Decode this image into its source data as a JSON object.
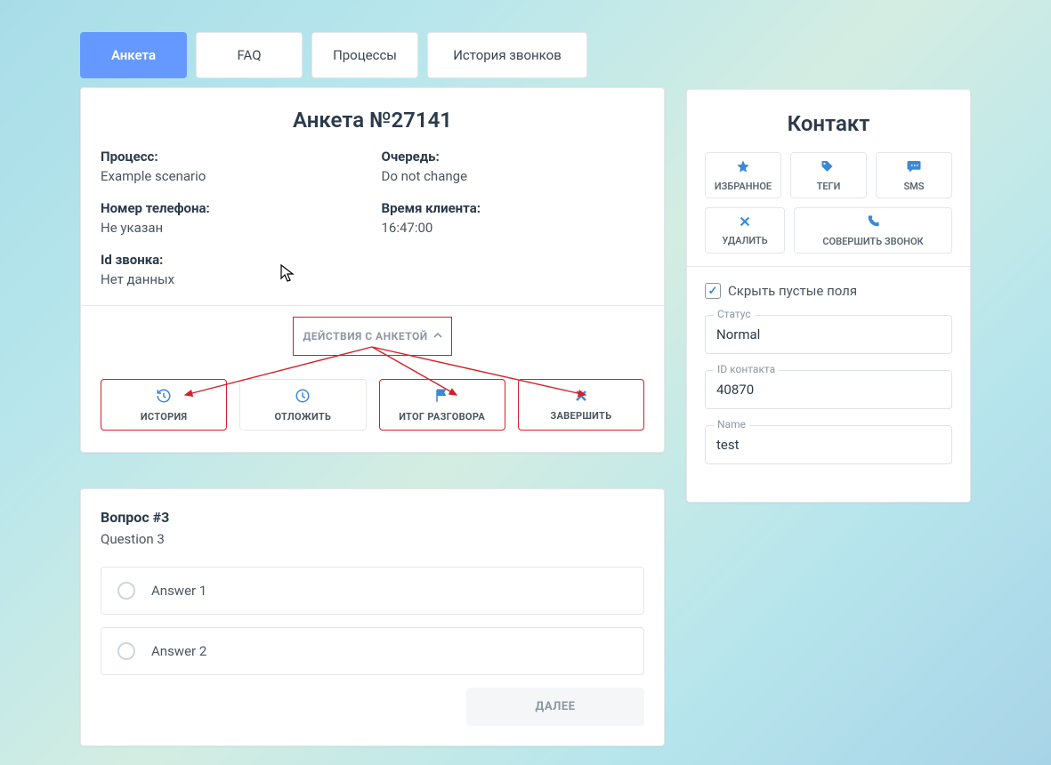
{
  "tabs": {
    "anketa": "Анкета",
    "faq": "FAQ",
    "processes": "Процессы",
    "call_history": "История звонков"
  },
  "anketa": {
    "title": "Анкета №27141",
    "process_label": "Процесс:",
    "process_value": "Example scenario",
    "queue_label": "Очередь:",
    "queue_value": "Do not change",
    "phone_label": "Номер телефона:",
    "phone_value": "Не указан",
    "client_time_label": "Время клиента:",
    "client_time_value": "16:47:00",
    "call_id_label": "Id звонка:",
    "call_id_value": "Нет данных",
    "actions_header": "ДЕЙСТВИЯ С АНКЕТОЙ",
    "actions": {
      "history": "ИСТОРИЯ",
      "postpone": "ОТЛОЖИТЬ",
      "call_result": "ИТОГ РАЗГОВОРА",
      "finish": "ЗАВЕРШИТЬ"
    }
  },
  "question": {
    "title": "Вопрос #3",
    "text": "Question 3",
    "answers": [
      "Answer 1",
      "Answer 2"
    ],
    "next": "ДАЛЕЕ"
  },
  "contact": {
    "title": "Контакт",
    "buttons": {
      "favorite": "ИЗБРАННОЕ",
      "tags": "ТЕГИ",
      "sms": "SMS",
      "delete": "УДАЛИТЬ",
      "call": "СОВЕРШИТЬ ЗВОНОК"
    },
    "hide_empty": "Скрыть пустые поля",
    "fields": {
      "status_label": "Статус",
      "status_value": "Normal",
      "id_label": "ID контакта",
      "id_value": "40870",
      "name_label": "Name",
      "name_value": "test"
    }
  }
}
